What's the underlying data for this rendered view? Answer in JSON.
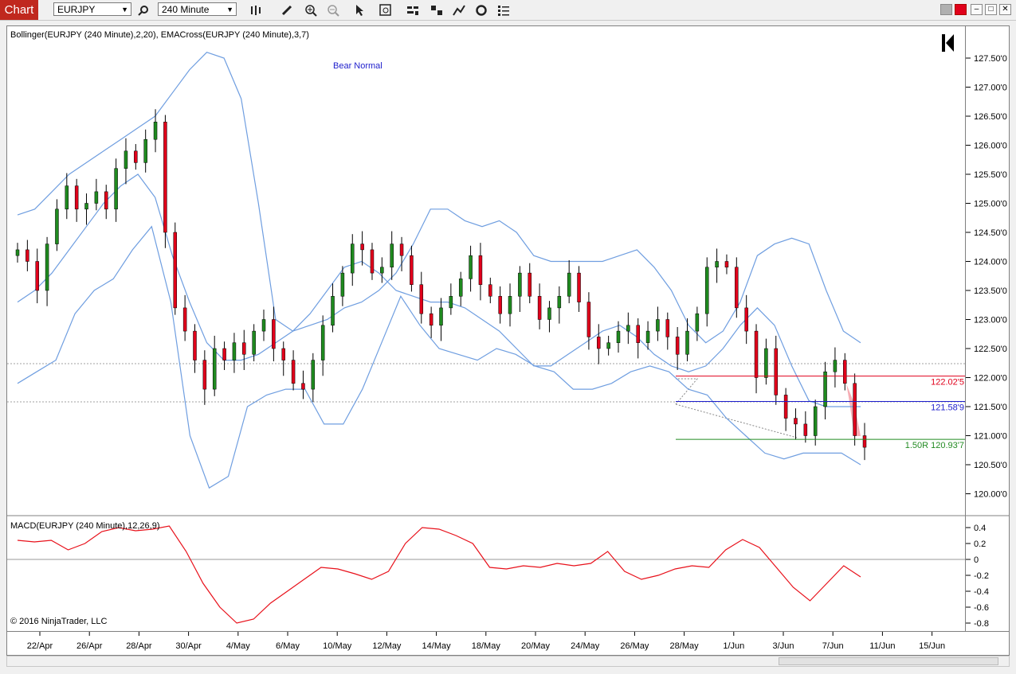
{
  "toolbar": {
    "chart_tab": "Chart",
    "instrument": "EURJPY",
    "interval": "240 Minute",
    "icons": [
      "search-icon",
      "bar-type-icon",
      "pencil-icon",
      "zoom-in-icon",
      "zoom-out-icon",
      "pointer-icon",
      "data-box-icon",
      "indicators-icon",
      "strategies-icon",
      "drawing-tools-icon",
      "refresh-icon",
      "properties-icon"
    ],
    "window_icons": [
      "link-icon",
      "close-red-icon",
      "minimize-icon",
      "maximize-icon",
      "close-icon"
    ]
  },
  "price_panel": {
    "indicator_label": "Bollinger(EURJPY (240 Minute),2,20), EMACross(EURJPY (240 Minute),3,7)",
    "annotation": "Bear Normal",
    "levels": [
      {
        "label": "122.02'5",
        "value": 122.025,
        "color": "#e0001b"
      },
      {
        "label": "121.58'9",
        "value": 121.589,
        "color": "#1e1ecc"
      },
      {
        "label": "1.50R 120.93'7",
        "value": 120.937,
        "color": "#228b22"
      }
    ]
  },
  "macd_panel": {
    "label": "MACD(EURJPY (240 Minute),12,26,9)",
    "copyright": "© 2016 NinjaTrader, LLC"
  },
  "chart_data": {
    "type": "candlestick",
    "price_ticks": [
      "127.50'0",
      "127.00'0",
      "126.50'0",
      "126.00'0",
      "125.50'0",
      "125.00'0",
      "124.50'0",
      "124.00'0",
      "123.50'0",
      "123.00'0",
      "122.50'0",
      "122.00'0",
      "121.50'0",
      "121.00'0",
      "120.50'0",
      "120.00'0"
    ],
    "price_tick_values": [
      127.5,
      127,
      126.5,
      126,
      125.5,
      125,
      124.5,
      124,
      123.5,
      123,
      122.5,
      122,
      121.5,
      121,
      120.5,
      120
    ],
    "macd_ticks": [
      "0.4",
      "0.2",
      "0",
      "-0.2",
      "-0.4",
      "-0.6",
      "-0.8"
    ],
    "macd_tick_values": [
      0.4,
      0.2,
      0,
      -0.2,
      -0.4,
      -0.6,
      -0.8
    ],
    "x_labels": [
      "22/Apr",
      "26/Apr",
      "28/Apr",
      "30/Apr",
      "4/May",
      "6/May",
      "10/May",
      "12/May",
      "14/May",
      "18/May",
      "20/May",
      "24/May",
      "26/May",
      "28/May",
      "1/Jun",
      "3/Jun",
      "7/Jun",
      "11/Jun",
      "15/Jun"
    ],
    "price_close": [
      124.2,
      124.0,
      123.5,
      124.3,
      124.9,
      125.3,
      124.9,
      125.0,
      125.2,
      124.9,
      125.6,
      125.9,
      125.7,
      126.1,
      126.4,
      124.5,
      123.2,
      122.8,
      122.3,
      121.8,
      122.5,
      122.3,
      122.6,
      122.4,
      122.8,
      123.0,
      122.5,
      122.3,
      121.9,
      121.8,
      122.3,
      122.9,
      123.4,
      123.8,
      124.3,
      124.2,
      123.8,
      123.9,
      124.3,
      124.1,
      123.6,
      123.1,
      122.9,
      123.2,
      123.4,
      123.7,
      124.1,
      123.6,
      123.4,
      123.1,
      123.4,
      123.8,
      123.4,
      123.0,
      123.2,
      123.4,
      123.8,
      123.3,
      122.7,
      122.5,
      122.6,
      122.8,
      122.9,
      122.6,
      122.8,
      123.0,
      122.7,
      122.4,
      122.8,
      123.1,
      123.9,
      124.0,
      123.9,
      123.2,
      122.8,
      122.0,
      122.5,
      121.7,
      121.3,
      121.2,
      121.0,
      121.5,
      122.1,
      122.3,
      121.9,
      121.0,
      120.8
    ],
    "bb_upper": [
      124.8,
      124.9,
      125.2,
      125.5,
      125.7,
      125.9,
      126.1,
      126.3,
      126.5,
      126.9,
      127.3,
      127.6,
      127.5,
      126.8,
      125.0,
      123.0,
      122.8,
      122.9,
      123.0,
      123.2,
      123.3,
      123.5,
      123.8,
      124.3,
      124.9,
      124.9,
      124.7,
      124.6,
      124.7,
      124.5,
      124.1,
      124.0,
      124.0,
      124.0,
      124.0,
      124.1,
      124.2,
      123.9,
      123.5,
      122.9,
      122.6,
      122.8,
      123.3,
      124.1,
      124.3,
      124.4,
      124.3,
      123.5,
      122.8,
      122.6
    ],
    "bb_middle": [
      123.3,
      123.5,
      123.8,
      124.2,
      124.6,
      125.0,
      125.3,
      125.5,
      125.1,
      124.1,
      123.3,
      122.6,
      122.3,
      122.3,
      122.4,
      122.6,
      122.8,
      123.1,
      123.5,
      123.9,
      124.0,
      123.8,
      123.5,
      123.4,
      123.3,
      123.3,
      123.2,
      123.0,
      122.8,
      122.5,
      122.2,
      122.2,
      122.4,
      122.6,
      122.8,
      122.9,
      122.7,
      122.4,
      122.2,
      122.1,
      122.2,
      122.5,
      122.9,
      123.2,
      122.9,
      122.2,
      121.6,
      121.5,
      121.5,
      121.5
    ],
    "bb_lower": [
      121.9,
      122.1,
      122.3,
      123.1,
      123.5,
      123.7,
      124.2,
      124.6,
      123.3,
      121.0,
      120.1,
      120.3,
      121.5,
      121.7,
      121.8,
      121.8,
      121.2,
      121.2,
      121.8,
      122.6,
      123.4,
      122.9,
      122.5,
      122.4,
      122.3,
      122.5,
      122.4,
      122.2,
      122.1,
      121.8,
      121.8,
      121.9,
      122.1,
      122.2,
      122.1,
      121.8,
      121.7,
      121.3,
      121.0,
      120.7,
      120.6,
      120.7,
      120.7,
      120.7,
      120.5
    ],
    "macd": [
      0.24,
      0.22,
      0.24,
      0.12,
      0.2,
      0.35,
      0.4,
      0.36,
      0.38,
      0.42,
      0.1,
      -0.3,
      -0.6,
      -0.8,
      -0.75,
      -0.55,
      -0.4,
      -0.25,
      -0.1,
      -0.12,
      -0.18,
      -0.25,
      -0.15,
      0.2,
      0.4,
      0.38,
      0.3,
      0.2,
      -0.1,
      -0.12,
      -0.08,
      -0.1,
      -0.05,
      -0.08,
      -0.05,
      0.1,
      -0.15,
      -0.25,
      -0.2,
      -0.12,
      -0.08,
      -0.1,
      0.12,
      0.25,
      0.15,
      -0.1,
      -0.35,
      -0.52,
      -0.3,
      -0.08,
      -0.22
    ]
  }
}
